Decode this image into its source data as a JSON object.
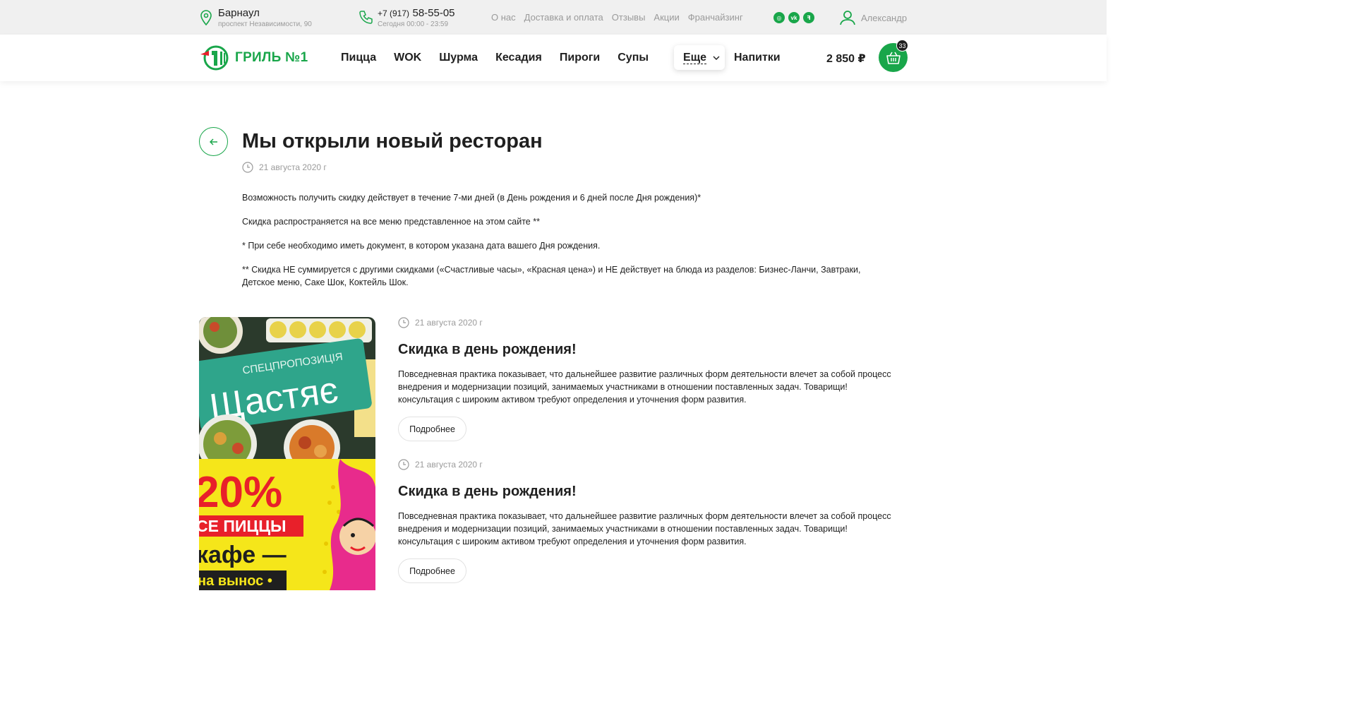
{
  "topbar": {
    "city": "Барнаул",
    "address": "проспект Независимости, 90",
    "phone_prefix": "+7 (917)",
    "phone_number": "58-55-05",
    "hours": "Сегодня 00:00 - 23:59",
    "links": [
      "О нас",
      "Доставка и оплата",
      "Отзывы",
      "Акции",
      "Франчайзинг"
    ],
    "social": [
      {
        "icon": "instagram-icon",
        "glyph": "◎"
      },
      {
        "icon": "vk-icon",
        "glyph": "vk"
      },
      {
        "icon": "tripadvisor-icon",
        "glyph": "ꟻ"
      }
    ],
    "user_name": "Александр"
  },
  "header": {
    "logo_text": "ГРИЛЬ №1",
    "nav": [
      "Пицца",
      "WOK",
      "Шурма",
      "Кесадия",
      "Пироги",
      "Супы"
    ],
    "more_label": "Еще",
    "drinks_label": "Напитки",
    "cart_total": "2 850 ₽",
    "cart_count": "33"
  },
  "article": {
    "title": "Мы открыли новый ресторан",
    "date": "21 августа 2020 г",
    "paragraphs": [
      "Возможность получить скидку действует в течение 7-ми дней (в День рождения и 6 дней после Дня рождения)*",
      "Скидка распространяется на все меню представленное на этом сайте **",
      "* При себе необходимо иметь документ, в котором указана дата вашего Дня рождения.",
      "** Скидка НЕ суммируется с другими скидками («Счастливые часы», «Красная цена») и НЕ действует на блюда из разделов: Бизнес-Ланчи, Завтраки, Детское меню, Саке Шок, Коктейль Шок."
    ]
  },
  "news": [
    {
      "date": "21 августа 2020 г",
      "title": "Скидка в день рождения!",
      "description": "Повседневная практика показывает, что дальнейшее развитие различных форм деятельности влечет за собой процесс внедрения и модернизации позиций, занимаемых участниками в отношении поставленных задач. Товарищи! консультация с широким активом требуют определения и уточнения форм развития.",
      "more_label": "Подробнее",
      "image_text_small": "СПЕЦПРОПОЗИЦІЯ",
      "image_text_big": "Щастяє"
    },
    {
      "date": "21 августа 2020 г",
      "title": "Скидка в день рождения!",
      "description": "Повседневная практика показывает, что дальнейшее развитие различных форм деятельности влечет за собой процесс внедрения и модернизации позиций, занимаемых участниками в отношении поставленных задач. Товарищи! консультация с широким активом требуют определения и уточнения форм развития.",
      "more_label": "Подробнее",
      "image_lines": [
        "20%",
        "СЕ ПИЦЦЫ",
        "кафе —",
        "на вынос •"
      ]
    }
  ],
  "colors": {
    "accent": "#19a64a",
    "muted": "#9a9a9a",
    "topbar_bg": "#f0f0f0",
    "promo_yellow": "#f5e61a",
    "promo_red": "#e8202a"
  }
}
